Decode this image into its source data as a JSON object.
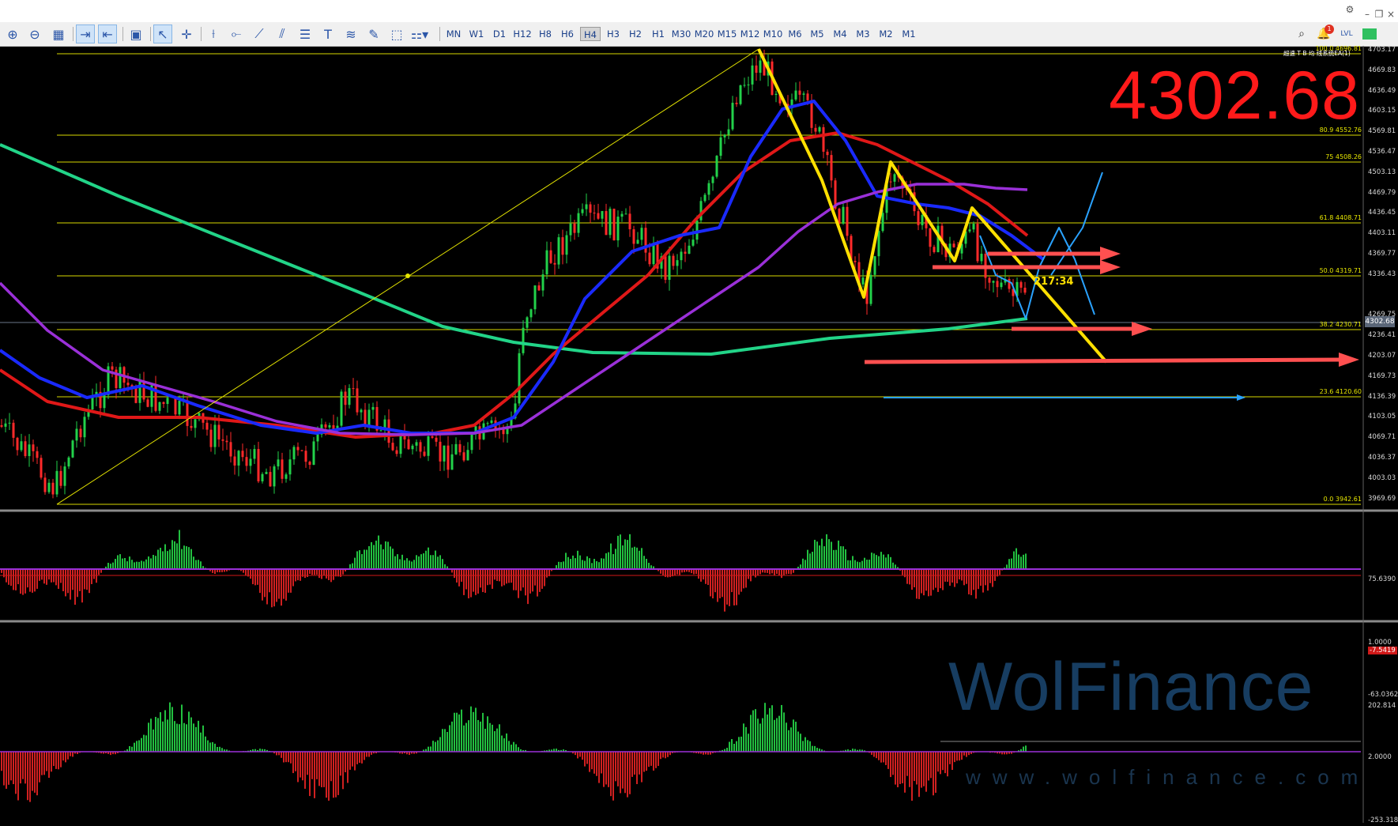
{
  "toolbar": {
    "timeframes": [
      "MN",
      "W1",
      "D1",
      "H12",
      "H8",
      "H6",
      "H4",
      "H3",
      "H2",
      "H1",
      "M30",
      "M20",
      "M15",
      "M12",
      "M10",
      "M6",
      "M5",
      "M4",
      "M3",
      "M2",
      "M1"
    ],
    "active_timeframe": "H4",
    "notification_count": "1"
  },
  "chart": {
    "current_price_big": "4302.68",
    "current_price_tag": "4302.68",
    "countdown": "217:34",
    "indicator_label": "超速 T B 均 线系统EA(1)",
    "price_axis": [
      "4703.17",
      "4669.83",
      "4636.49",
      "4603.15",
      "4569.81",
      "4536.47",
      "4503.13",
      "4469.79",
      "4436.45",
      "4403.11",
      "4369.77",
      "4336.43",
      "4302.68",
      "4269.75",
      "4236.41",
      "4203.07",
      "4169.73",
      "4136.39",
      "4103.05",
      "4069.71",
      "4036.37",
      "4003.03",
      "3969.69"
    ],
    "fib_levels": [
      {
        "label": "100.0  4696.81",
        "color": "#e6e600"
      },
      {
        "label": "80.9  4552.76",
        "color": "#e6e600"
      },
      {
        "label": "75  4508.26",
        "color": "#e6e600"
      },
      {
        "label": "61.8  4408.71",
        "color": "#e6e600"
      },
      {
        "label": "50.0  4319.71",
        "color": "#e6e600"
      },
      {
        "label": "38.2  4230.71",
        "color": "#e6e600"
      },
      {
        "label": "23.6  4120.60",
        "color": "#e6e600"
      },
      {
        "label": "0.0  3942.61",
        "color": "#e6e600"
      }
    ]
  },
  "indicator1": {
    "axis": [
      "75.6390",
      "1.0000",
      "-7.5419",
      "-63.0362"
    ]
  },
  "indicator2": {
    "axis": [
      "202.814",
      "2.0000",
      "-253.318"
    ]
  },
  "watermark": {
    "brand": "WolFinance",
    "url": "www.wolfinance.com"
  }
}
